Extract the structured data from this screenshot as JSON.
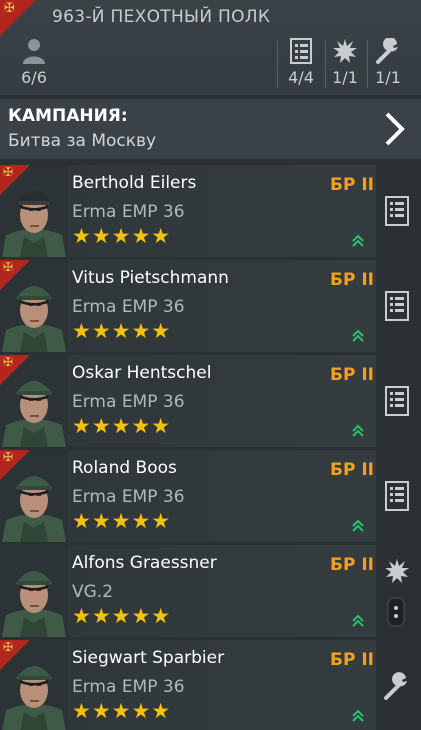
{
  "header": {
    "title": "963-Й ПЕХОТНЫЙ ПОЛК",
    "soldiers_count": "6/6",
    "squad_slots": "4/4",
    "explosive_slots": "1/1",
    "engineer_slots": "1/1"
  },
  "campaign": {
    "label": "КАМПАНИЯ:",
    "value": "Битва за Москву"
  },
  "soldiers": [
    {
      "name": "Berthold Eilers",
      "weapon": "Erma EMP 36",
      "rank": "БР II",
      "stars": "★★★★★",
      "side_icon": "list-icon"
    },
    {
      "name": "Vitus Pietschmann",
      "weapon": "Erma EMP 36",
      "rank": "БР II",
      "stars": "★★★★★",
      "side_icon": "list-icon"
    },
    {
      "name": "Oskar Hentschel",
      "weapon": "Erma EMP 36",
      "rank": "БР II",
      "stars": "★★★★★",
      "side_icon": "list-icon"
    },
    {
      "name": "Roland Boos",
      "weapon": "Erma EMP 36",
      "rank": "БР II",
      "stars": "★★★★★",
      "side_icon": "list-icon"
    },
    {
      "name": "Alfons Graessner",
      "weapon": "VG.2",
      "rank": "БР II",
      "stars": "★★★★★",
      "side_icon": "explosion-icon"
    },
    {
      "name": "Siegwart Sparbier",
      "weapon": "Erma EMP 36",
      "rank": "БР II",
      "stars": "★★★★★",
      "side_icon": "wrench-icon"
    }
  ],
  "colors": {
    "background": "#2a3033",
    "rank": "#f2a21b",
    "stars": "#f4c20d",
    "badge": "#b3261e",
    "upgrade": "#27c46b"
  }
}
